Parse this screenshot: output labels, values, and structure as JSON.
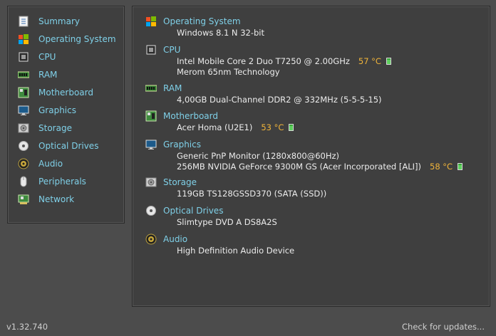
{
  "sidebar": {
    "items": [
      {
        "label": "Summary",
        "icon": "summary-icon"
      },
      {
        "label": "Operating System",
        "icon": "windows-logo-icon"
      },
      {
        "label": "CPU",
        "icon": "cpu-chip-icon"
      },
      {
        "label": "RAM",
        "icon": "ram-module-icon"
      },
      {
        "label": "Motherboard",
        "icon": "motherboard-icon"
      },
      {
        "label": "Graphics",
        "icon": "monitor-icon"
      },
      {
        "label": "Storage",
        "icon": "hard-drive-icon"
      },
      {
        "label": "Optical Drives",
        "icon": "disc-icon"
      },
      {
        "label": "Audio",
        "icon": "speaker-icon"
      },
      {
        "label": "Peripherals",
        "icon": "mouse-icon"
      },
      {
        "label": "Network",
        "icon": "network-card-icon"
      }
    ]
  },
  "summary": {
    "os": {
      "title": "Operating System",
      "value": "Windows 8.1 N 32-bit"
    },
    "cpu": {
      "title": "CPU",
      "model": "Intel Mobile Core 2 Duo T7250 @ 2.00GHz",
      "temp": "57 °C",
      "tech": "Merom 65nm Technology"
    },
    "ram": {
      "title": "RAM",
      "value": "4,00GB Dual-Channel DDR2 @ 332MHz (5-5-5-15)"
    },
    "motherboard": {
      "title": "Motherboard",
      "value": "Acer Homa (U2E1)",
      "temp": "53 °C"
    },
    "graphics": {
      "title": "Graphics",
      "monitor": "Generic PnP Monitor (1280x800@60Hz)",
      "gpu": "256MB NVIDIA GeForce 9300M GS (Acer Incorporated [ALI])",
      "temp": "58 °C"
    },
    "storage": {
      "title": "Storage",
      "value": "119GB TS128GSSD370 (SATA (SSD))"
    },
    "optical": {
      "title": "Optical Drives",
      "value": "Slimtype DVD A DS8A2S"
    },
    "audio": {
      "title": "Audio",
      "value": "High Definition Audio Device"
    }
  },
  "footer": {
    "version": "v1.32.740",
    "check_updates": "Check for updates..."
  },
  "colors": {
    "accent": "#7fd0e8",
    "temp": "#f0b43a",
    "bg": "#4c4c4c",
    "panel": "#3f3f3f"
  }
}
